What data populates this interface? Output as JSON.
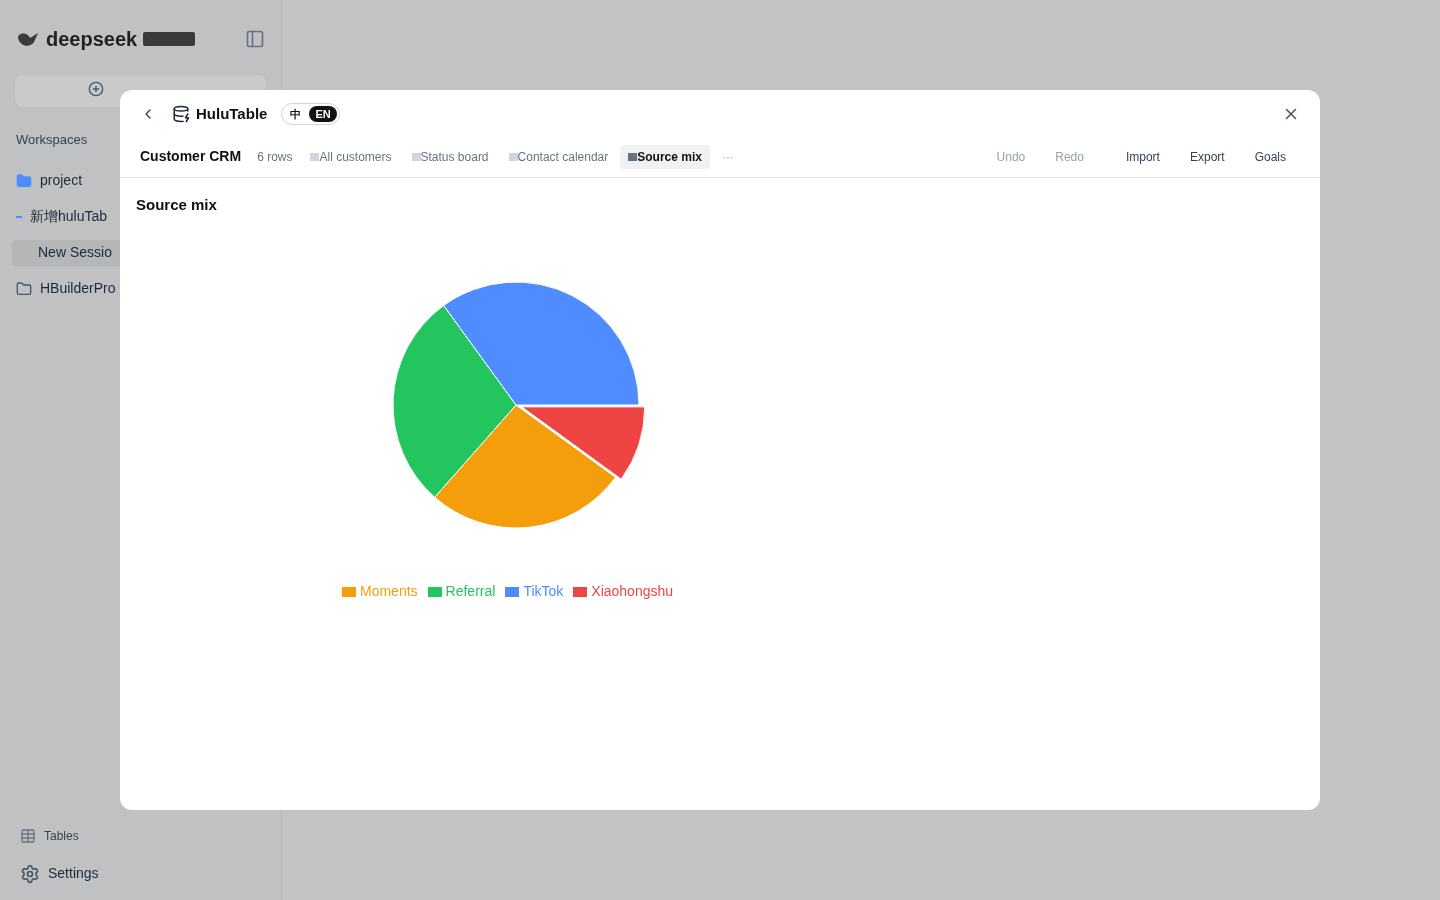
{
  "sidebar": {
    "brand": "deepseek",
    "section_label": "Workspaces",
    "items": [
      {
        "label": "project",
        "kind": "folder-filled",
        "selected": false
      },
      {
        "label": "新增huluTab",
        "kind": "sub",
        "selected": false
      },
      {
        "label": "New Sessio",
        "kind": "plain",
        "selected": true
      },
      {
        "label": "HBuilderPro",
        "kind": "folder",
        "selected": false
      }
    ],
    "footer": [
      {
        "label": "Tables",
        "kind": "tables"
      },
      {
        "label": "Settings",
        "kind": "settings"
      }
    ]
  },
  "modal": {
    "title": "HuluTable",
    "languages": [
      {
        "label": "中",
        "selected": false
      },
      {
        "label": "EN",
        "selected": true
      }
    ],
    "table_name": "Customer CRM",
    "row_count": "6 rows",
    "views": [
      {
        "label": "All customers",
        "selected": false
      },
      {
        "label": "Status board",
        "selected": false
      },
      {
        "label": "Contact calendar",
        "selected": false
      },
      {
        "label": "Source mix",
        "selected": true
      }
    ],
    "more": "···",
    "actions": [
      {
        "label": "Undo",
        "disabled": true
      },
      {
        "label": "Redo",
        "disabled": true
      },
      {
        "label": "Import",
        "disabled": false
      },
      {
        "label": "Export",
        "disabled": false
      },
      {
        "label": "Goals",
        "disabled": false
      }
    ],
    "chart_data": {
      "type": "pie",
      "title": "Source mix",
      "categories": [
        "Moments",
        "Referral",
        "TikTok",
        "Xiaohongshu"
      ],
      "legend": "bottom",
      "series": [
        {
          "colors": [
            "#f59e0b",
            "#22c55e",
            "#4f8cff",
            "#ef4444"
          ],
          "values": [
            26.5,
            28.5,
            35,
            10
          ]
        }
      ]
    }
  }
}
